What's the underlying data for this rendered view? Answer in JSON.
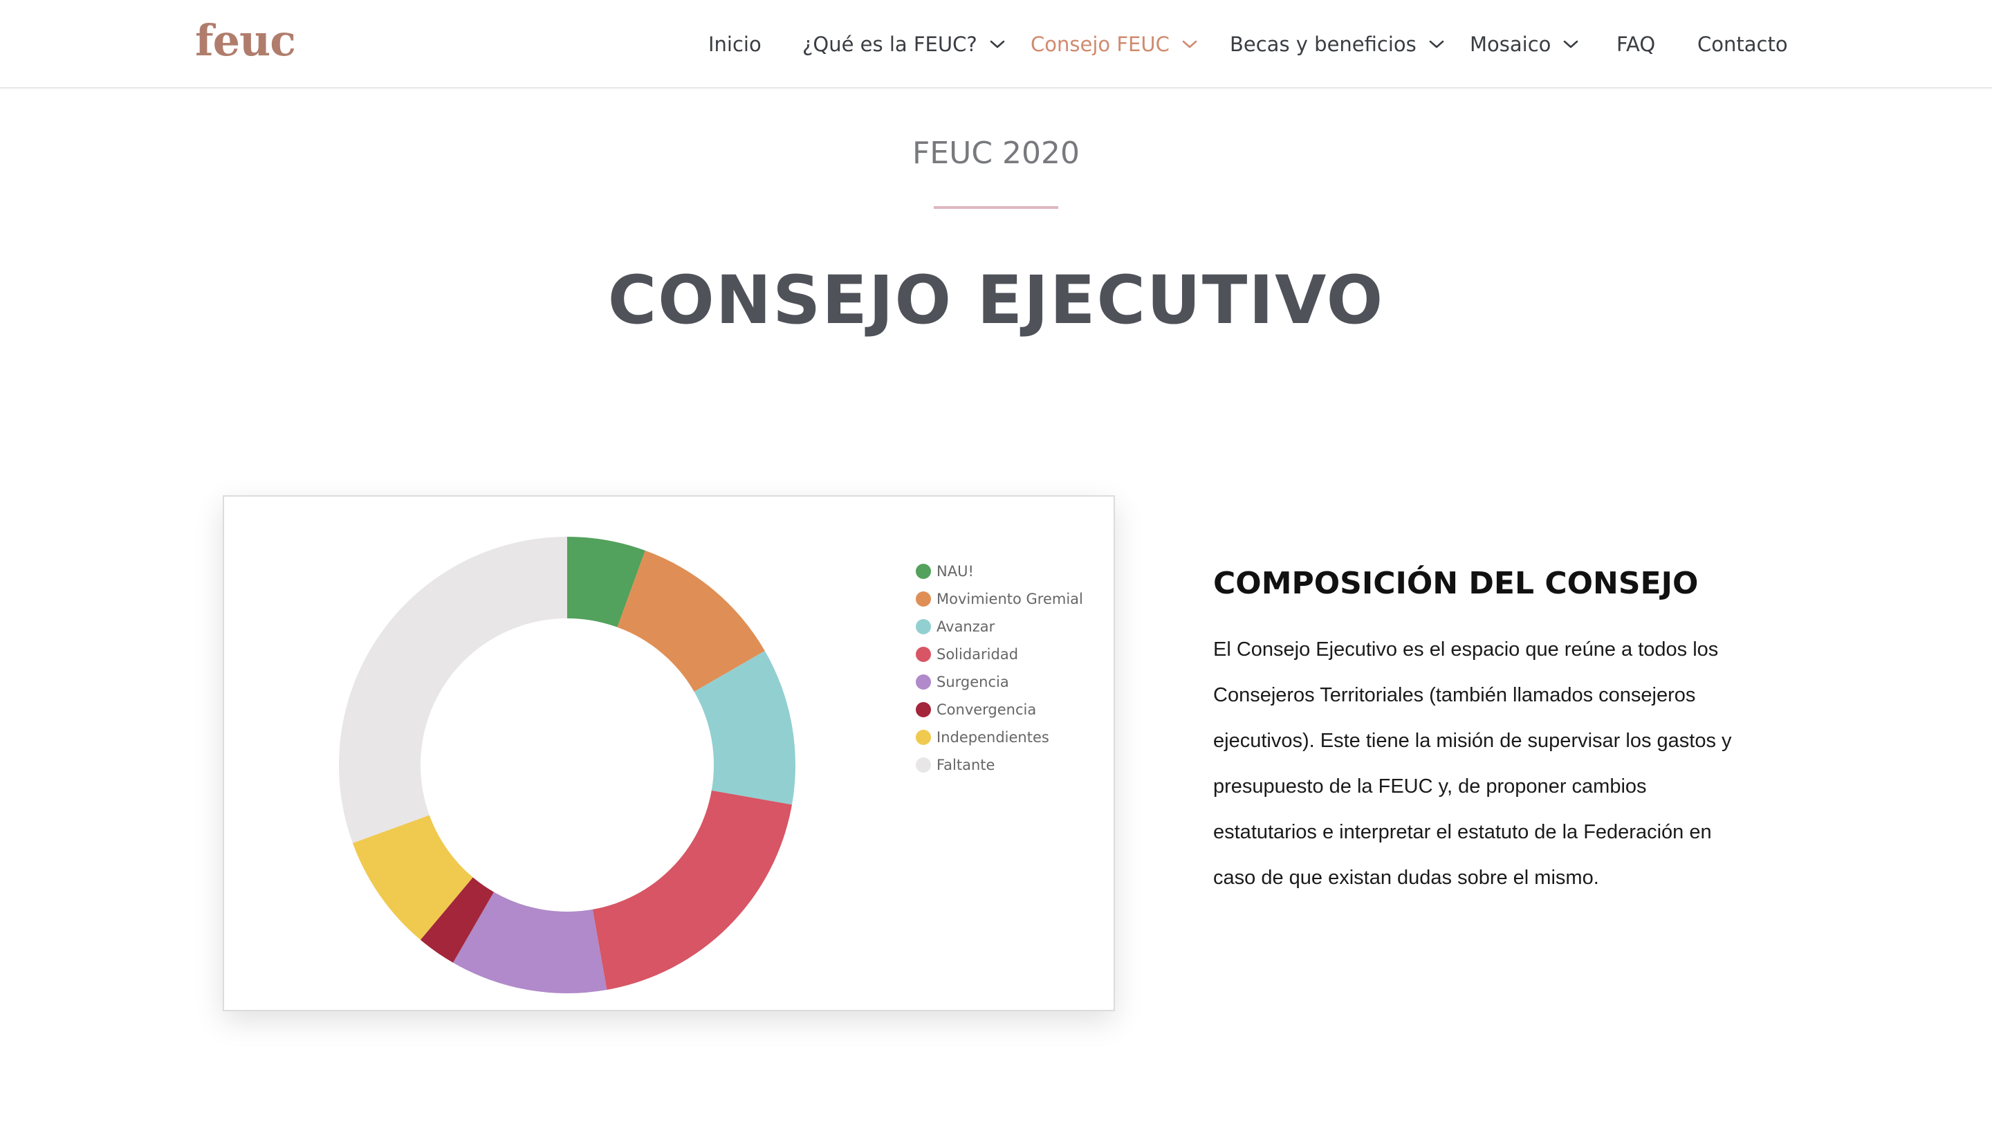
{
  "header": {
    "logo": "feuc",
    "nav": [
      {
        "label": "Inicio",
        "dropdown": false,
        "active": false
      },
      {
        "label": "¿Qué es la FEUC?",
        "dropdown": true,
        "active": false
      },
      {
        "label": "Consejo FEUC",
        "dropdown": true,
        "active": true
      },
      {
        "label": "Becas y beneficios",
        "dropdown": true,
        "active": false
      },
      {
        "label": "Mosaico",
        "dropdown": true,
        "active": false
      },
      {
        "label": "FAQ",
        "dropdown": false,
        "active": false
      },
      {
        "label": "Contacto",
        "dropdown": false,
        "active": false
      }
    ]
  },
  "hero": {
    "subtitle": "FEUC 2020",
    "title": "CONSEJO EJECUTIVO"
  },
  "info": {
    "title": "COMPOSICIÓN DEL CONSEJO",
    "text": "El Consejo Ejecutivo es el espacio que reúne a todos los Consejeros Territoriales (también llamados consejeros ejecutivos). Este tiene la misión de supervisar los gastos y presupuesto de la FEUC y, de proponer cambios estatutarios e interpretar el estatuto de la Federación en caso de que existan dudas sobre el mismo."
  },
  "colors": {
    "accent": "#d08a6e",
    "logo": "#b07d6c",
    "text": "#3a3d42"
  },
  "chart_data": {
    "type": "pie",
    "subtype": "doughnut",
    "legend_position": "right",
    "series": [
      {
        "name": "NAU!",
        "value": 2,
        "color": "#52a15c"
      },
      {
        "name": "Movimiento Gremial",
        "value": 4,
        "color": "#df8f55"
      },
      {
        "name": "Avanzar",
        "value": 4,
        "color": "#92cfd1"
      },
      {
        "name": "Solidaridad",
        "value": 7,
        "color": "#d75564"
      },
      {
        "name": "Surgencia",
        "value": 4,
        "color": "#b08aca"
      },
      {
        "name": "Convergencia",
        "value": 1,
        "color": "#a3263b"
      },
      {
        "name": "Independientes",
        "value": 3,
        "color": "#f0c94f"
      },
      {
        "name": "Faltante",
        "value": 11,
        "color": "#e8e6e6"
      }
    ]
  }
}
